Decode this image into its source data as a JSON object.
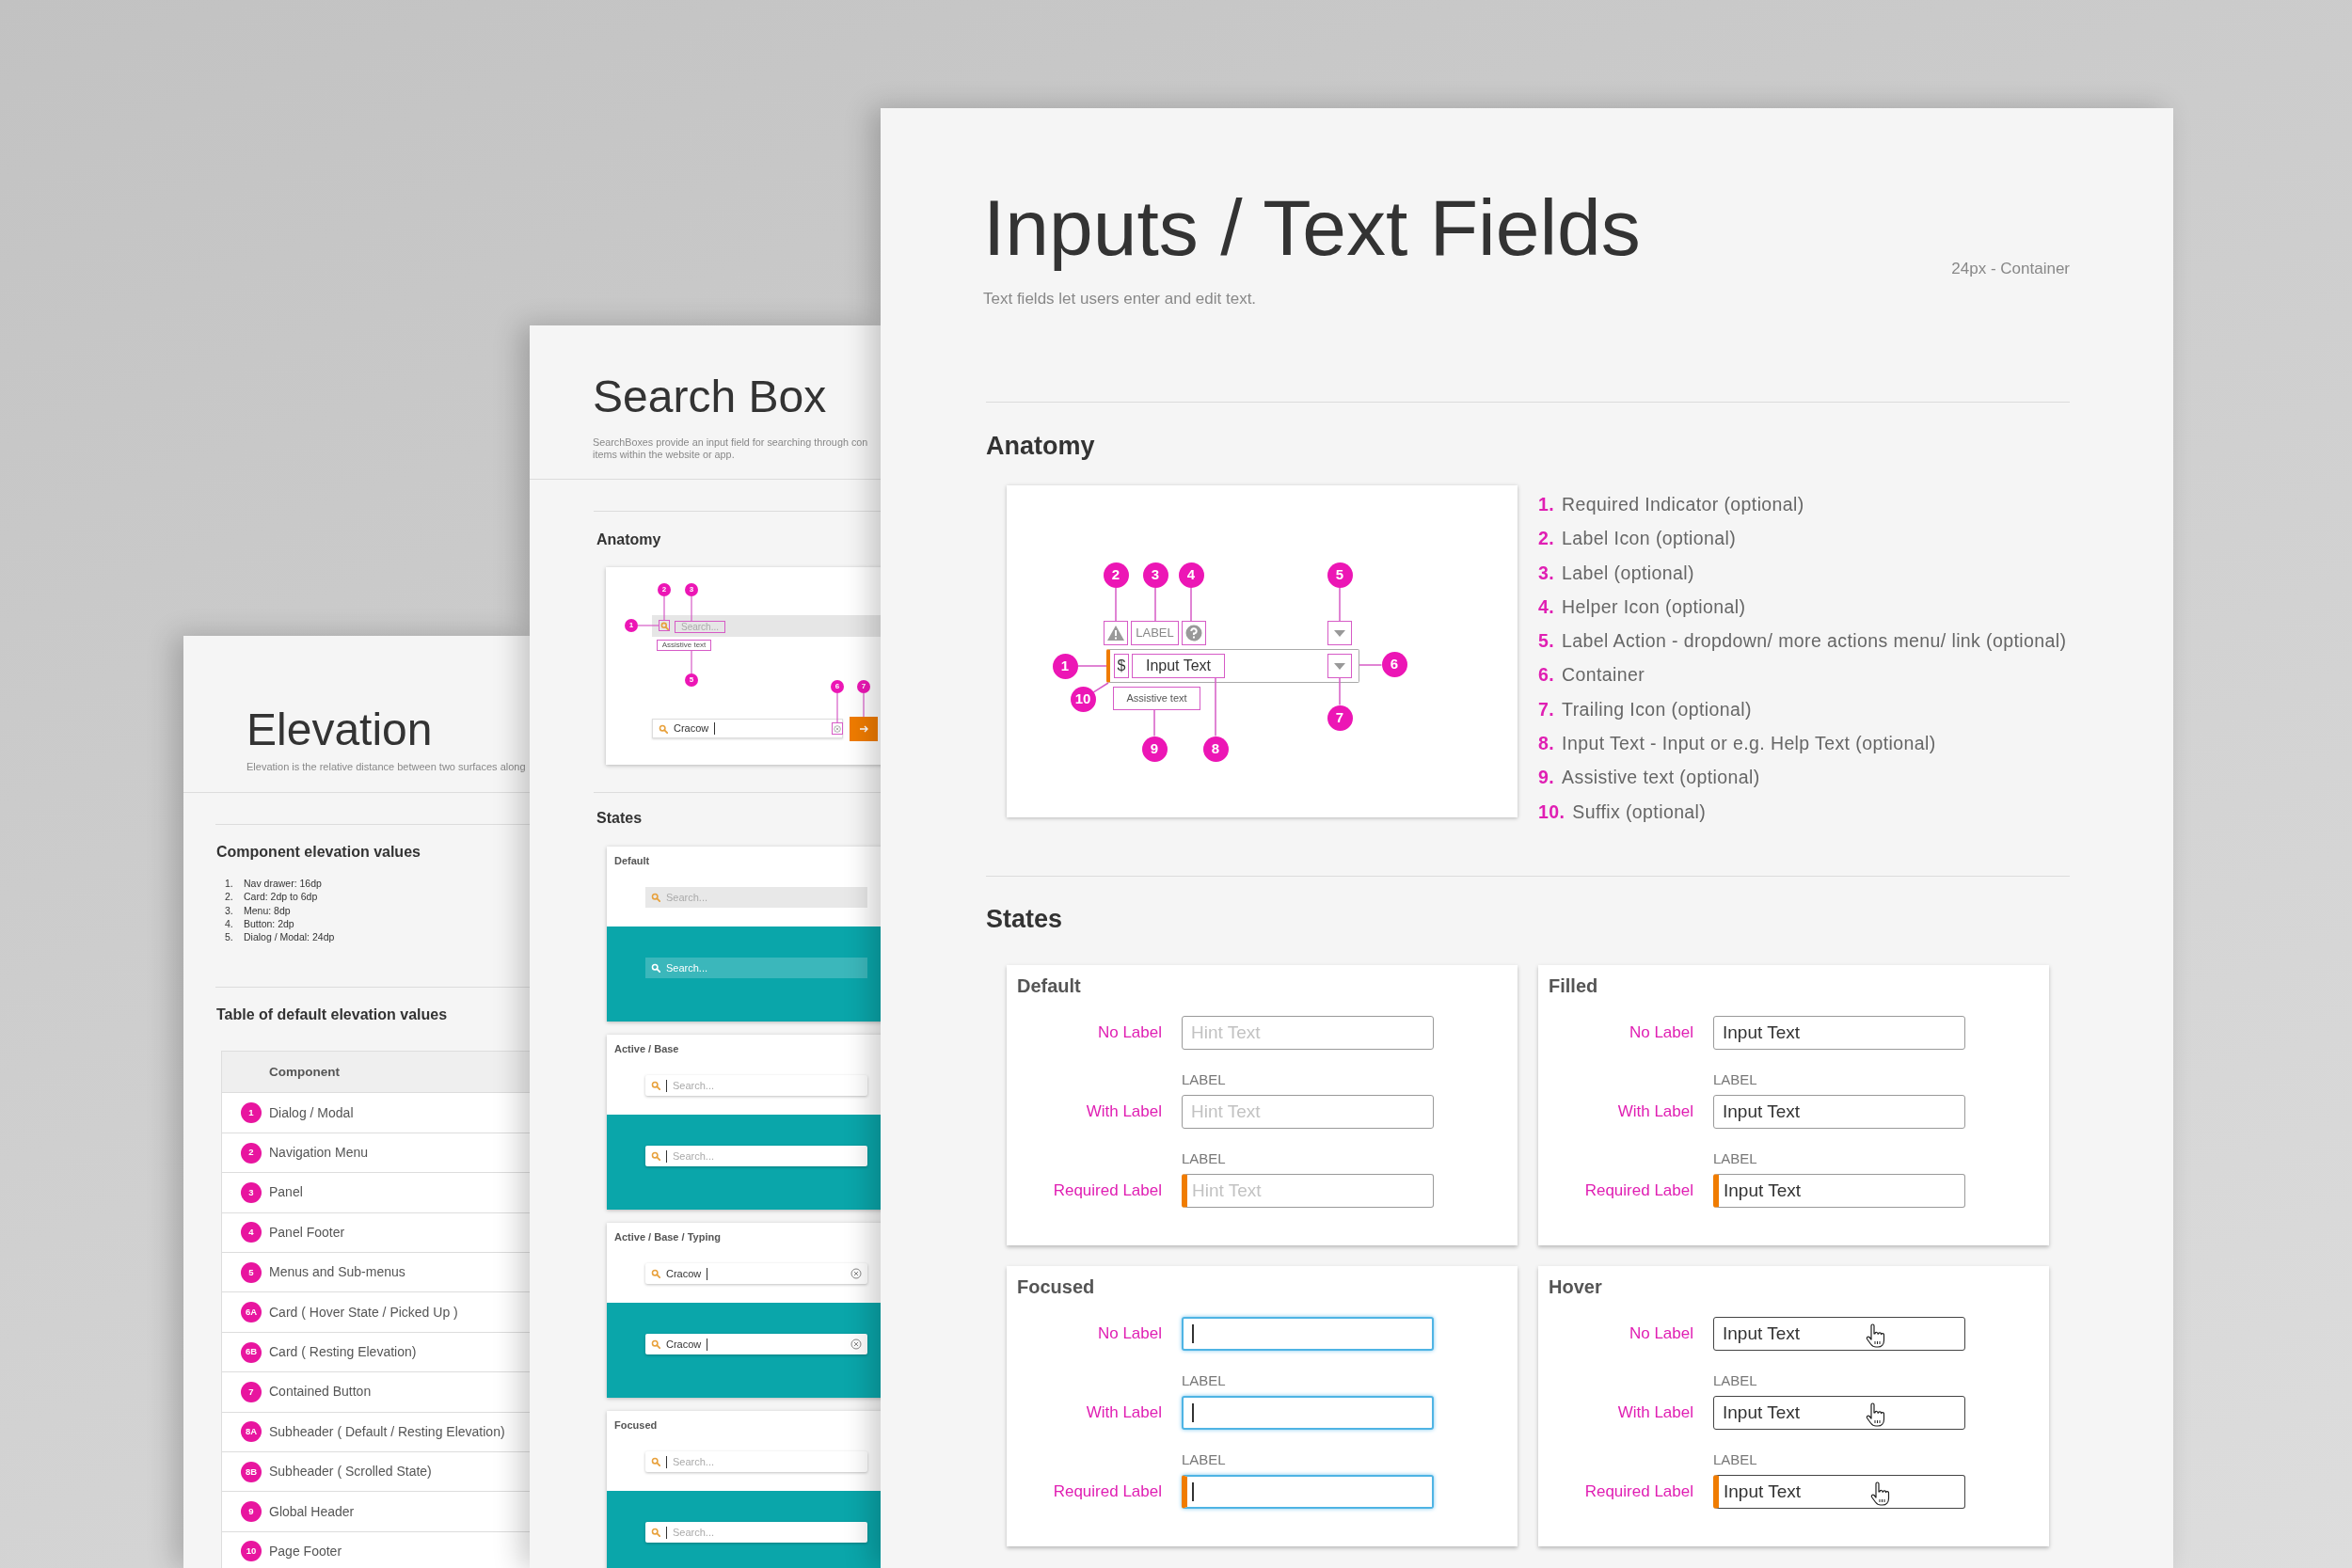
{
  "elevation_page": {
    "title": "Elevation",
    "description": "Elevation is the relative distance between two surfaces along",
    "component_values": {
      "heading": "Component elevation values",
      "items": [
        {
          "number": "1.",
          "text": "Nav drawer: 16dp"
        },
        {
          "number": "2.",
          "text": "Card: 2dp to 6dp"
        },
        {
          "number": "3.",
          "text": "Menu: 8dp"
        },
        {
          "number": "4.",
          "text": "Button: 2dp"
        },
        {
          "number": "5.",
          "text": "Dialog / Modal: 24dp"
        }
      ]
    },
    "table": {
      "heading": "Table of default elevation values",
      "columns": [
        "Component"
      ],
      "rows": [
        {
          "badge": "1",
          "component": "Dialog / Modal"
        },
        {
          "badge": "2",
          "component": "Navigation Menu"
        },
        {
          "badge": "3",
          "component": "Panel"
        },
        {
          "badge": "4",
          "component": "Panel Footer"
        },
        {
          "badge": "5",
          "component": "Menus and Sub-menus"
        },
        {
          "badge": "6A",
          "component": "Card ( Hover State / Picked Up )"
        },
        {
          "badge": "6B",
          "component": "Card ( Resting Elevation)"
        },
        {
          "badge": "7",
          "component": "Contained Button"
        },
        {
          "badge": "8A",
          "component": "Subheader ( Default / Resting Elevation)"
        },
        {
          "badge": "8B",
          "component": "Subheader ( Scrolled State)"
        },
        {
          "badge": "9",
          "component": "Global Header"
        },
        {
          "badge": "10",
          "component": "Page Footer"
        }
      ]
    }
  },
  "search_box_page": {
    "title": "Search Box",
    "description": "SearchBoxes provide an input field for searching through con\nitems within the website or app.",
    "anatomy": {
      "heading": "Anatomy",
      "callouts": [
        "1",
        "2",
        "3",
        "5",
        "6",
        "7"
      ],
      "placeholder": "Search...",
      "assistive_text": "Assistive text",
      "value": "Cracow"
    },
    "states": {
      "heading": "States",
      "cards": [
        {
          "title": "Default",
          "kind": "default",
          "fields": [
            {
              "placeholder": "Search..."
            },
            {
              "placeholder": "Search..."
            }
          ]
        },
        {
          "title": "Active / Base",
          "kind": "active",
          "fields": [
            {
              "placeholder": "Search..."
            },
            {
              "placeholder": "Search..."
            }
          ]
        },
        {
          "title": "Active / Base / Typing",
          "kind": "typing",
          "fields": [
            {
              "value": "Cracow"
            },
            {
              "value": "Cracow"
            }
          ]
        },
        {
          "title": "Focused",
          "kind": "focused",
          "fields": [
            {
              "placeholder": "Search..."
            },
            {
              "placeholder": "Search..."
            }
          ]
        }
      ]
    }
  },
  "text_fields_page": {
    "title": "Inputs / Text Fields",
    "description": "Text fields let users enter and edit text.",
    "note": "24px - Container",
    "anatomy": {
      "heading": "Anatomy",
      "diagram": {
        "label": "LABEL",
        "prefix": "$",
        "value": "Input Text",
        "assistive_text": "Assistive text",
        "callouts": [
          "2",
          "3",
          "4",
          "5",
          "1",
          "6",
          "10",
          "9",
          "8",
          "7"
        ]
      },
      "legend": [
        {
          "number": "1.",
          "text": "Required Indicator (optional)"
        },
        {
          "number": "2.",
          "text": "Label Icon (optional)"
        },
        {
          "number": "3.",
          "text": "Label (optional)"
        },
        {
          "number": "4.",
          "text": "Helper Icon (optional)"
        },
        {
          "number": "5.",
          "text": "Label Action - dropdown/ more actions menu/ link (optional)"
        },
        {
          "number": "6.",
          "text": "Container"
        },
        {
          "number": "7.",
          "text": "Trailing Icon (optional)"
        },
        {
          "number": "8.",
          "text": "Input Text - Input or e.g. Help Text (optional)"
        },
        {
          "number": "9.",
          "text": "Assistive text (optional)"
        },
        {
          "number": "10.",
          "text": "Suffix (optional)"
        }
      ]
    },
    "states": {
      "heading": "States",
      "cards": [
        {
          "title": "Default",
          "kind": "default",
          "rows": [
            {
              "caption": "No Label",
              "placeholder": "Hint Text",
              "required": false
            },
            {
              "caption": "With Label",
              "label": "LABEL",
              "placeholder": "Hint Text",
              "required": false
            },
            {
              "caption": "Required Label",
              "label": "LABEL",
              "placeholder": "Hint Text",
              "required": true
            }
          ]
        },
        {
          "title": "Filled",
          "kind": "filled",
          "rows": [
            {
              "caption": "No Label",
              "value": "Input Text",
              "required": false
            },
            {
              "caption": "With Label",
              "label": "LABEL",
              "value": "Input Text",
              "required": false
            },
            {
              "caption": "Required Label",
              "label": "LABEL",
              "value": "Input Text",
              "required": true
            }
          ]
        },
        {
          "title": "Focused",
          "kind": "focused",
          "rows": [
            {
              "caption": "No Label",
              "required": false
            },
            {
              "caption": "With Label",
              "label": "LABEL",
              "required": false
            },
            {
              "caption": "Required Label",
              "label": "LABEL",
              "required": true
            }
          ]
        },
        {
          "title": "Hover",
          "kind": "hover",
          "rows": [
            {
              "caption": "No Label",
              "value": "Input Text",
              "required": false
            },
            {
              "caption": "With Label",
              "label": "LABEL",
              "value": "Input Text",
              "required": false
            },
            {
              "caption": "Required Label",
              "label": "LABEL",
              "value": "Input Text",
              "required": true
            }
          ]
        }
      ]
    }
  }
}
